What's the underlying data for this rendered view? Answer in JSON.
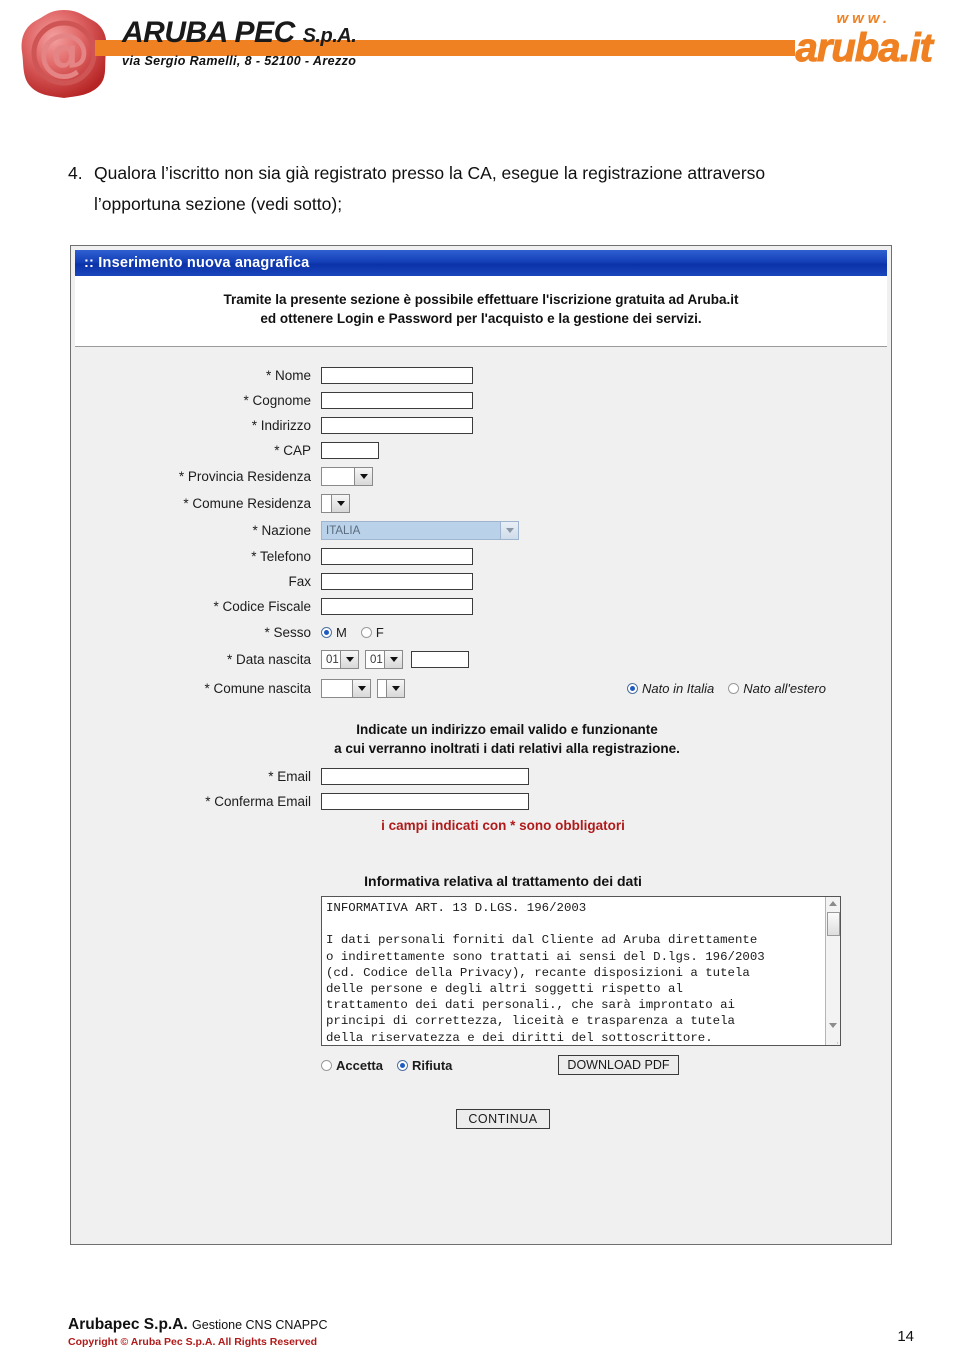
{
  "header": {
    "brand_name": "ARUBA PEC",
    "brand_suffix": "S.p.A.",
    "brand_address": "via Sergio Ramelli, 8 - 52100 - Arezzo",
    "site_www": "www.",
    "site_domain": "aruba.it",
    "seal_icon": "at-sign-wax-seal-icon"
  },
  "body_text": {
    "number": "4.",
    "line1": "Qualora l’iscritto non sia già registrato presso la CA, esegue la registrazione attraverso",
    "line2": "l’opportuna sezione (vedi sotto);"
  },
  "panel": {
    "title": ":: Inserimento nuova anagrafica",
    "intro_line1": "Tramite la presente sezione è possibile effettuare l'iscrizione gratuita ad Aruba.it",
    "intro_line2": "ed ottenere Login e Password per l'acquisto e la gestione dei servizi."
  },
  "form": {
    "fields": [
      {
        "label": "* Nome",
        "value": "",
        "placeholder": ""
      },
      {
        "label": "* Cognome",
        "value": "",
        "placeholder": ""
      },
      {
        "label": "* Indirizzo",
        "value": "",
        "placeholder": ""
      },
      {
        "label": "* CAP",
        "value": "",
        "placeholder": ""
      },
      {
        "label": "* Provincia Residenza",
        "value": "",
        "placeholder": ""
      },
      {
        "label": "* Comune Residenza",
        "value": "",
        "placeholder": ""
      },
      {
        "label": "* Nazione",
        "value": "ITALIA",
        "placeholder": ""
      },
      {
        "label": "* Telefono",
        "value": "",
        "placeholder": ""
      },
      {
        "label": "Fax",
        "value": "",
        "placeholder": ""
      },
      {
        "label": "* Codice Fiscale",
        "value": "",
        "placeholder": ""
      },
      {
        "label": "* Sesso",
        "value": "M",
        "placeholder": ""
      },
      {
        "label": "* Data nascita",
        "value": "",
        "placeholder": ""
      },
      {
        "label": "* Comune nascita",
        "value": "",
        "placeholder": ""
      },
      {
        "label": "* Email",
        "value": "",
        "placeholder": ""
      },
      {
        "label": "* Conferma Email",
        "value": "",
        "placeholder": ""
      }
    ],
    "sesso": {
      "male_label": "M",
      "female_label": "F",
      "selected": "M"
    },
    "data_nascita": {
      "day": "01",
      "month": "01",
      "year": ""
    },
    "nato": {
      "italia_label": "Nato in Italia",
      "estero_label": "Nato all'estero",
      "selected": "Nato in Italia"
    },
    "email_note_line1": "Indicate un indirizzo email valido e funzionante",
    "email_note_line2": "a cui verranno inoltrati i dati relativi alla registrazione.",
    "required_note": "i campi indicati con * sono obbligatori"
  },
  "informativa": {
    "title": "Informativa relativa al trattamento dei dati",
    "text": "INFORMATIVA ART. 13 D.LGS. 196/2003\n\nI dati personali forniti dal Cliente ad Aruba direttamente\no indirettamente sono trattati ai sensi del D.lgs. 196/2003\n(cd. Codice della Privacy), recante disposizioni a tutela\ndelle persone e degli altri soggetti rispetto al\ntrattamento dei dati personali., che sarà improntato ai\nprincipi di correttezza, liceità e trasparenza a tutela\ndella riservatezza e dei diritti del sottoscrittore.",
    "accetta_label": "Accetta",
    "rifiuta_label": "Rifiuta",
    "selected": "Rifiuta",
    "download_label": "DOWNLOAD PDF",
    "continua_label": "CONTINUA"
  },
  "footer": {
    "company": "Arubapec S.p.A.",
    "service": "Gestione CNS CNAPPC",
    "copyright": "Copyright © Aruba Pec S.p.A. All Rights Reserved",
    "page_number": "14"
  },
  "colors": {
    "brand_orange": "#ef8122",
    "titlebar_blue": "#1440b8",
    "required_red": "#b11a1a",
    "panel_bg": "#f0f0f0"
  }
}
